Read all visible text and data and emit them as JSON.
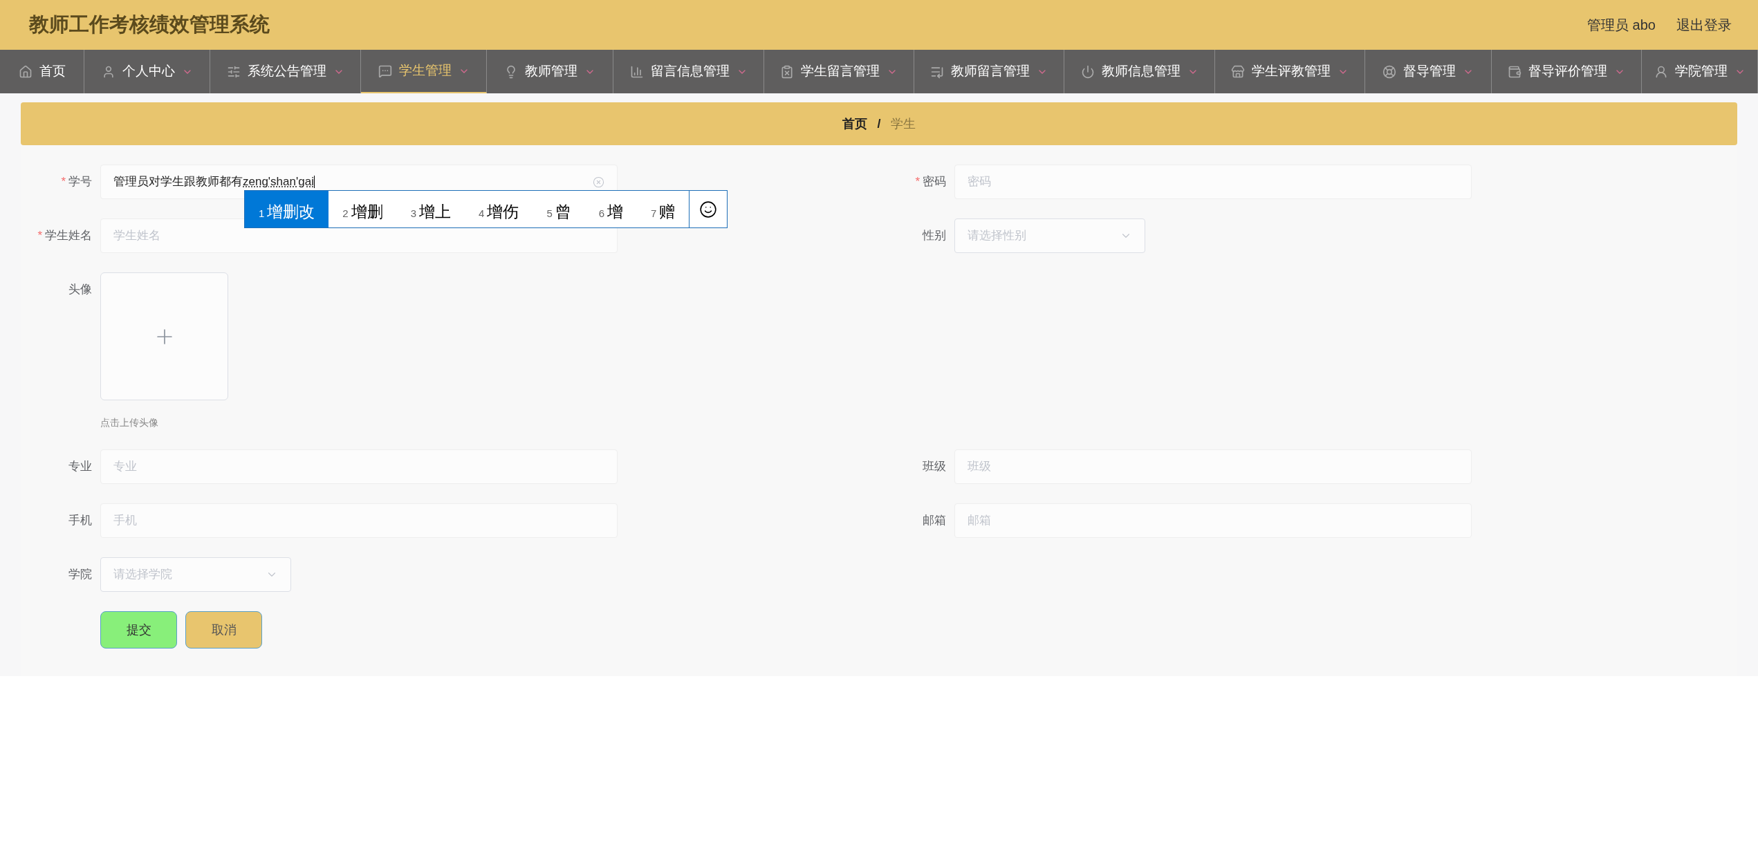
{
  "header": {
    "title": "教师工作考核绩效管理系统",
    "user": "管理员 abo",
    "logout": "退出登录"
  },
  "nav": [
    {
      "label": "首页",
      "selected": false,
      "dropdown": false
    },
    {
      "label": "个人中心",
      "selected": false,
      "dropdown": true
    },
    {
      "label": "系统公告管理",
      "selected": false,
      "dropdown": true
    },
    {
      "label": "学生管理",
      "selected": true,
      "dropdown": true
    },
    {
      "label": "教师管理",
      "selected": false,
      "dropdown": true
    },
    {
      "label": "留言信息管理",
      "selected": false,
      "dropdown": true
    },
    {
      "label": "学生留言管理",
      "selected": false,
      "dropdown": true
    },
    {
      "label": "教师留言管理",
      "selected": false,
      "dropdown": true
    },
    {
      "label": "教师信息管理",
      "selected": false,
      "dropdown": true
    },
    {
      "label": "学生评教管理",
      "selected": false,
      "dropdown": true
    },
    {
      "label": "督导管理",
      "selected": false,
      "dropdown": true
    },
    {
      "label": "督导评价管理",
      "selected": false,
      "dropdown": true
    },
    {
      "label": "学院管理",
      "selected": false,
      "dropdown": true
    }
  ],
  "breadcrumb": [
    {
      "label": "首页",
      "current": false
    },
    {
      "separator": "/",
      "label": "学生",
      "current": true
    }
  ],
  "form": {
    "rows": [
      [
        {
          "kind": "input",
          "mark": "*",
          "label": "学号",
          "value": "管理员对学生跟教师都有",
          "composing": "zeng'shan'gai"
        },
        {
          "kind": "input",
          "mark": "*",
          "label": "密码",
          "placeholder": "密码"
        }
      ],
      [
        {
          "kind": "input",
          "mark": "*",
          "label": "学生姓名",
          "placeholder": "学生姓名"
        },
        {
          "kind": "select",
          "label": "性别",
          "placeholder": "请选择性别"
        }
      ],
      [
        {
          "kind": "upload",
          "label": "头像",
          "hint": "点击上传头像"
        }
      ],
      [
        {
          "kind": "input",
          "label": "专业",
          "placeholder": "专业"
        },
        {
          "kind": "input",
          "label": "班级",
          "placeholder": "班级"
        }
      ],
      [
        {
          "kind": "input",
          "label": "手机",
          "placeholder": "手机"
        },
        {
          "kind": "input",
          "label": "邮箱",
          "placeholder": "邮箱"
        }
      ],
      [
        {
          "kind": "select",
          "label": "学院",
          "placeholder": "请选择学院"
        }
      ]
    ],
    "buttons": [
      {
        "label": "提交",
        "kind": "submit"
      },
      {
        "label": "取消",
        "kind": "cancel"
      }
    ]
  },
  "ime": {
    "candidates": [
      {
        "number": "1",
        "text": "增删改",
        "selected": true
      },
      {
        "number": "2",
        "text": "增删",
        "selected": false
      },
      {
        "number": "3",
        "text": "增上",
        "selected": false
      },
      {
        "number": "4",
        "text": "增伤",
        "selected": false
      },
      {
        "number": "5",
        "text": "曾",
        "selected": false
      },
      {
        "number": "6",
        "text": "增",
        "selected": false
      },
      {
        "number": "7",
        "text": "赠",
        "selected": false
      }
    ]
  }
}
